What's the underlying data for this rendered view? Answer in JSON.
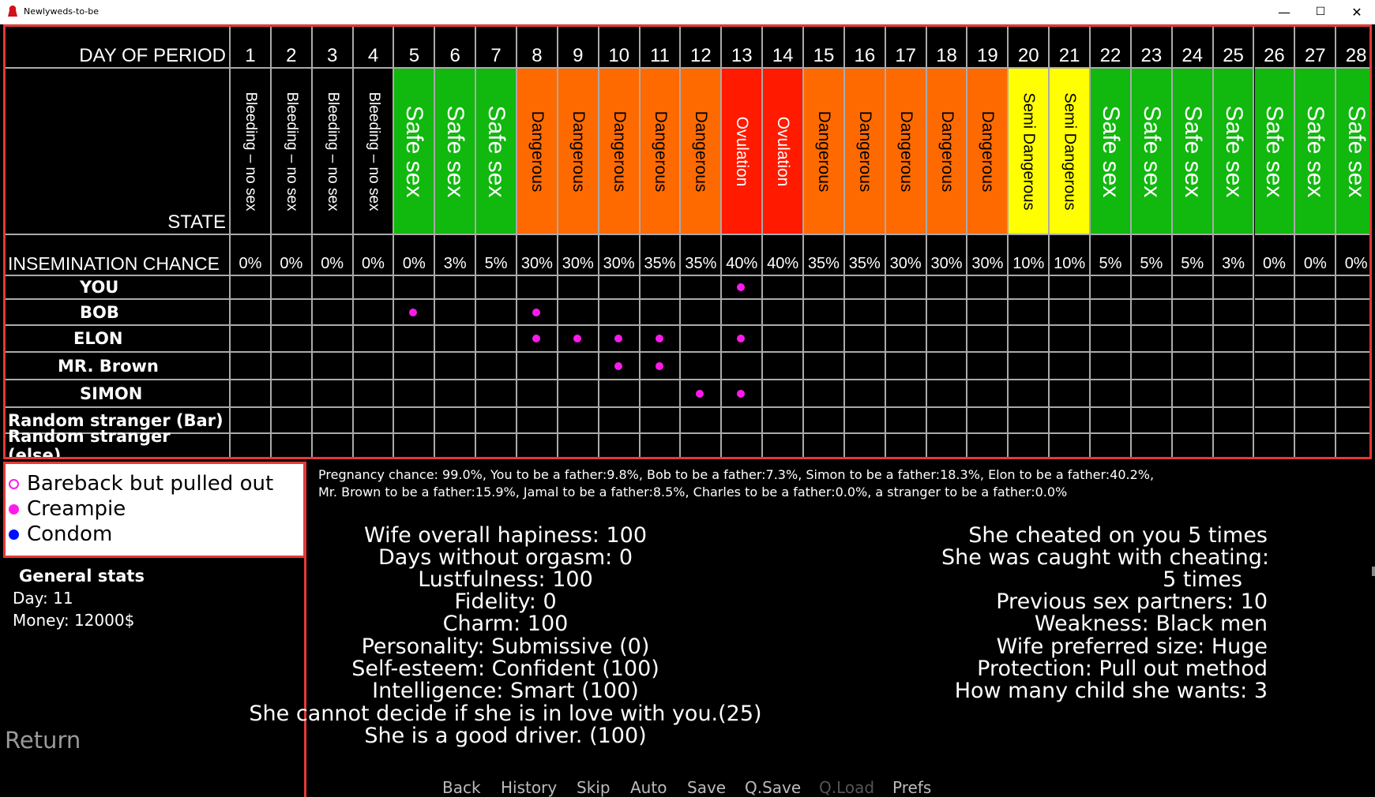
{
  "window": {
    "title": "Newlyweds-to-be",
    "minimize": "—",
    "maximize": "☐",
    "close": "✕"
  },
  "calendar": {
    "header_label": "DAY OF PERIOD",
    "state_label": "STATE",
    "chance_label": "INSEMINATION CHANCE",
    "days": [
      {
        "day": "1",
        "state": "Bleeding – no sex",
        "kind": "bleeding",
        "chance": "0%"
      },
      {
        "day": "2",
        "state": "Bleeding – no sex",
        "kind": "bleeding",
        "chance": "0%"
      },
      {
        "day": "3",
        "state": "Bleeding – no sex",
        "kind": "bleeding",
        "chance": "0%"
      },
      {
        "day": "4",
        "state": "Bleeding – no sex",
        "kind": "bleeding",
        "chance": "0%"
      },
      {
        "day": "5",
        "state": "Safe sex",
        "kind": "safe",
        "chance": "0%"
      },
      {
        "day": "6",
        "state": "Safe sex",
        "kind": "safe",
        "chance": "3%"
      },
      {
        "day": "7",
        "state": "Safe sex",
        "kind": "safe",
        "chance": "5%"
      },
      {
        "day": "8",
        "state": "Dangerous",
        "kind": "dangerous",
        "chance": "30%"
      },
      {
        "day": "9",
        "state": "Dangerous",
        "kind": "dangerous",
        "chance": "30%"
      },
      {
        "day": "10",
        "state": "Dangerous",
        "kind": "dangerous",
        "chance": "30%"
      },
      {
        "day": "11",
        "state": "Dangerous",
        "kind": "dangerous",
        "chance": "35%"
      },
      {
        "day": "12",
        "state": "Dangerous",
        "kind": "dangerous",
        "chance": "35%"
      },
      {
        "day": "13",
        "state": "Ovulation",
        "kind": "ovulation",
        "chance": "40%"
      },
      {
        "day": "14",
        "state": "Ovulation",
        "kind": "ovulation",
        "chance": "40%"
      },
      {
        "day": "15",
        "state": "Dangerous",
        "kind": "dangerous",
        "chance": "35%"
      },
      {
        "day": "16",
        "state": "Dangerous",
        "kind": "dangerous",
        "chance": "35%"
      },
      {
        "day": "17",
        "state": "Dangerous",
        "kind": "dangerous",
        "chance": "30%"
      },
      {
        "day": "18",
        "state": "Dangerous",
        "kind": "dangerous",
        "chance": "30%"
      },
      {
        "day": "19",
        "state": "Dangerous",
        "kind": "dangerous",
        "chance": "30%"
      },
      {
        "day": "20",
        "state": "Semi Dangerous",
        "kind": "semi",
        "chance": "10%"
      },
      {
        "day": "21",
        "state": "Semi Dangerous",
        "kind": "semi",
        "chance": "10%"
      },
      {
        "day": "22",
        "state": "Safe sex",
        "kind": "safe",
        "chance": "5%"
      },
      {
        "day": "23",
        "state": "Safe sex",
        "kind": "safe",
        "chance": "5%"
      },
      {
        "day": "24",
        "state": "Safe sex",
        "kind": "safe",
        "chance": "5%"
      },
      {
        "day": "25",
        "state": "Safe sex",
        "kind": "safe",
        "chance": "3%"
      },
      {
        "day": "26",
        "state": "Safe sex",
        "kind": "safe",
        "chance": "0%"
      },
      {
        "day": "27",
        "state": "Safe sex",
        "kind": "safe",
        "chance": "0%"
      },
      {
        "day": "28",
        "state": "Safe sex",
        "kind": "safe",
        "chance": "0%"
      }
    ],
    "state_colors": {
      "bleeding": "#000000",
      "safe": "#11b80e",
      "dangerous": "#ff6a00",
      "ovulation": "#ff1a00",
      "semi": "#ffff00"
    },
    "partners": [
      {
        "name": "YOU",
        "creampie_days": [
          13
        ]
      },
      {
        "name": "BOB",
        "creampie_days": [
          5,
          8
        ]
      },
      {
        "name": "ELON",
        "creampie_days": [
          8,
          9,
          10,
          11,
          13
        ]
      },
      {
        "name": "MR. Brown",
        "creampie_days": [
          10,
          11
        ]
      },
      {
        "name": "SIMON",
        "creampie_days": [
          12,
          13
        ]
      },
      {
        "name": "Random stranger (Bar)",
        "creampie_days": []
      },
      {
        "name": "Random stranger (else)",
        "creampie_days": []
      }
    ]
  },
  "legend": {
    "items": [
      {
        "label": "Bareback but pulled out",
        "color": "#ff1aeb",
        "style": "ring"
      },
      {
        "label": "Creampie",
        "color": "#ff1aeb",
        "style": "filled"
      },
      {
        "label": "Condom",
        "color": "#0010ff",
        "style": "filled"
      }
    ]
  },
  "general_stats": {
    "title": "General stats",
    "day": "Day: 11",
    "money": "Money: 12000$"
  },
  "return_label": "Return",
  "summary": {
    "line1": "Pregnancy chance: 99.0%, You to be a father:9.8%, Bob to be a father:7.3%, Simon to be a father:18.3%, Elon to be a father:40.2%,",
    "line2": "Mr. Brown to be a father:15.9%, Jamal to be a father:8.5%, Charles to be a father:0.0%, a stranger to be a father:0.0%"
  },
  "stats_left": [
    "Wife overall hapiness: 100",
    "Days without orgasm: 0",
    "Lustfulness: 100",
    "Fidelity: 0",
    "Charm: 100",
    "Personality: Submissive (0)",
    "Self-esteem: Confident (100)",
    "Intelligence: Smart (100)",
    "She cannot decide if she is in love with you.(25)",
    "She is a good driver. (100)"
  ],
  "stats_right": [
    "She cheated on you 5 times",
    "She was caught with cheating:",
    "5 times",
    "Previous sex partners: 10",
    "Weakness: Black men",
    "Wife preferred size: Huge",
    "Protection: Pull out method",
    "How many child she wants: 3"
  ],
  "menu": {
    "back": "Back",
    "history": "History",
    "skip": "Skip",
    "auto": "Auto",
    "save": "Save",
    "qsave": "Q.Save",
    "qload": "Q.Load",
    "prefs": "Prefs"
  }
}
